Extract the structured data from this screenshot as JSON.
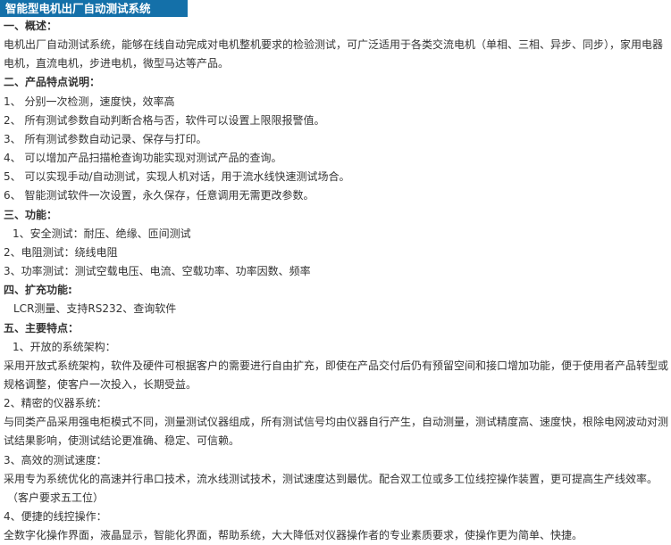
{
  "title": "智能型电机出厂自动测试系统",
  "s1": {
    "heading": "一、概述：",
    "body": "电机出厂自动测试系统，能够在线自动完成对电机整机要求的检验测试，可广泛适用于各类交流电机（单相、三相、异步、同步），家用电器电机，直流电机，步进电机，微型马达等产品。"
  },
  "s2": {
    "heading": "二、产品特点说明：",
    "items": [
      "1、 分别一次检测，速度快，效率高",
      "2、 所有测试参数自动判断合格与否，软件可以设置上限限报警值。",
      "3、 所有测试参数自动记录、保存与打印。",
      "4、 可以增加产品扫描枪查询功能实现对测试产品的查询。",
      "5、 可以实现手动/自动测试，实现人机对话，用于流水线快速测试场合。",
      "6、 智能测试软件一次设置，永久保存，任意调用无需更改参数。"
    ]
  },
  "s3": {
    "heading": "三、功能：",
    "items": [
      "1、安全测试：耐压、绝缘、匝间测试",
      "2、电阻测试：绕线电阻",
      "3、功率测试：测试空载电压、电流、空载功率、功率因数、频率"
    ]
  },
  "s4": {
    "heading": "四、扩充功能:",
    "body": "LCR测量、支持RS232、查询软件"
  },
  "s5": {
    "heading": "五、主要特点：",
    "p1_title": "1、开放的系统架构：",
    "p1_body": "采用开放式系统架构，软件及硬件可根据客户的需要进行自由扩充，即使在产品交付后仍有预留空间和接口增加功能，便于使用者产品转型或规格调整，使客户一次投入，长期受益。",
    "p2_title": "2、精密的仪器系统：",
    "p2_body": "与同类产品采用强电柜模式不同，测量测试仪器组成，所有测试信号均由仪器自行产生，自动测量，测试精度高、速度快，根除电网波动对测试结果影响，使测试结论更准确、稳定、可信赖。",
    "p3_title": "3、高效的测试速度：",
    "p3_body": "采用专为系统优化的高速并行串口技术，流水线测试技术，测试速度达到最优。配合双工位或多工位线控操作装置，更可提高生产线效率。",
    "p3_note": "（客户要求五工位）",
    "p4_title": "4、便捷的线控操作：",
    "p4_body": "全数字化操作界面，液晶显示，智能化界面，帮助系统，大大降低对仪器操作者的专业素质要求，使操作更为简单、快捷。"
  }
}
